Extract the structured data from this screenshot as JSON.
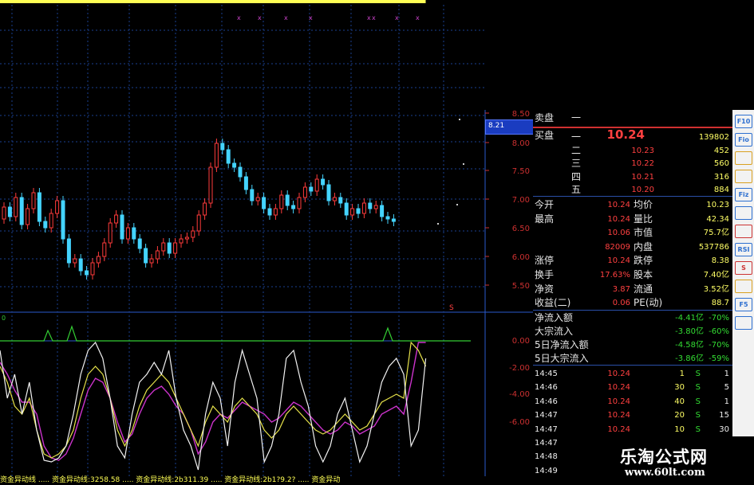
{
  "price_axis": {
    "ticks": [
      "8.50",
      "8.00",
      "7.50",
      "7.00",
      "6.50",
      "6.00",
      "5.50"
    ],
    "current_price_tag": "8.21"
  },
  "indicator_axis": {
    "ticks": [
      "0.00",
      "-2.00",
      "-4.00",
      "-6.00"
    ],
    "marker": "0"
  },
  "quote": {
    "ask_label": "卖盘",
    "ask_rank": "一",
    "bid_label": "买盘",
    "bid_rows": [
      {
        "rank": "一",
        "price": "10.24",
        "volume": "139802"
      },
      {
        "rank": "二",
        "price": "10.23",
        "volume": "452"
      },
      {
        "rank": "三",
        "price": "10.22",
        "volume": "560"
      },
      {
        "rank": "四",
        "price": "10.21",
        "volume": "316"
      },
      {
        "rank": "五",
        "price": "10.20",
        "volume": "884"
      }
    ],
    "stats": [
      {
        "l1": "今开",
        "v1": "10.24",
        "l2": "均价",
        "v2": "10.23"
      },
      {
        "l1": "最高",
        "v1": "10.24",
        "l2": "量比",
        "v2": "42.34"
      },
      {
        "l1": "",
        "v1": "10.06",
        "l2": "市值",
        "v2": "75.7亿"
      },
      {
        "l1": "",
        "v1": "82009",
        "l2": "内盘",
        "v2": "537786"
      },
      {
        "l1": "涨停",
        "v1": "10.24",
        "l2": "跌停",
        "v2": "8.38"
      },
      {
        "l1": "换手",
        "v1": "17.63%",
        "l2": "股本",
        "v2": "7.40亿"
      },
      {
        "l1": "净资",
        "v1": "3.87",
        "l2": "流通",
        "v2": "3.52亿"
      },
      {
        "l1": "收益(二)",
        "v1": "0.06",
        "l2": "PE(动)",
        "v2": "88.7"
      }
    ],
    "flows": [
      {
        "label": "净流入额",
        "amount": "-4.41亿",
        "pct": "-70%"
      },
      {
        "label": "大宗流入",
        "amount": "-3.80亿",
        "pct": "-60%"
      },
      {
        "label": "5日净流入额",
        "amount": "-4.58亿",
        "pct": "-70%"
      },
      {
        "label": "5日大宗流入",
        "amount": "-3.86亿",
        "pct": "-59%"
      }
    ],
    "ticks": [
      {
        "time": "14:45",
        "price": "10.24",
        "vol": "1",
        "flag": "S",
        "n": "1"
      },
      {
        "time": "14:46",
        "price": "10.24",
        "vol": "30",
        "flag": "S",
        "n": "5"
      },
      {
        "time": "14:46",
        "price": "10.24",
        "vol": "40",
        "flag": "S",
        "n": "1"
      },
      {
        "time": "14:47",
        "price": "10.24",
        "vol": "20",
        "flag": "S",
        "n": "15"
      },
      {
        "time": "14:47",
        "price": "10.24",
        "vol": "10",
        "flag": "S",
        "n": "30"
      },
      {
        "time": "14:47",
        "price": "",
        "vol": "",
        "flag": "",
        "n": ""
      },
      {
        "time": "14:48",
        "price": "",
        "vol": "",
        "flag": "",
        "n": ""
      },
      {
        "time": "14:49",
        "price": "",
        "vol": "",
        "flag": "",
        "n": ""
      }
    ]
  },
  "toolbar": [
    "F10",
    "Fio",
    "",
    "",
    "Fiz",
    "",
    "",
    "RSI",
    "S",
    "",
    "F5",
    ""
  ],
  "watermark": {
    "name": "乐淘公式网",
    "url": "www.60lt.com"
  },
  "bottom_status": "资金异动线 ..... 资金异动线:3258.58 ..... 资金异动线:2b311.39 ..... 资金异动线:2b1?9.2? ..... 资金异动"
}
